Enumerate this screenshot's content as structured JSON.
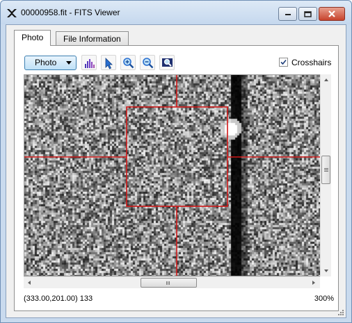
{
  "window": {
    "title": "00000958.fit - FITS Viewer",
    "controls": [
      "minimize",
      "maximize",
      "close"
    ]
  },
  "tabs": [
    {
      "label": "Photo",
      "active": true
    },
    {
      "label": "File Information",
      "active": false
    }
  ],
  "toolbar": {
    "view_mode": {
      "selected": "Photo"
    },
    "buttons": [
      {
        "name": "histogram",
        "icon": "histogram-icon"
      },
      {
        "name": "select",
        "icon": "pointer-icon"
      },
      {
        "name": "zoom-in",
        "icon": "zoom-in-icon"
      },
      {
        "name": "zoom-out",
        "icon": "zoom-out-icon"
      },
      {
        "name": "zoom-fit",
        "icon": "zoom-fit-icon"
      }
    ],
    "crosshairs": {
      "label": "Crosshairs",
      "checked": true
    }
  },
  "status": {
    "readout": "(333.00,201.00) 133",
    "zoom": "300%"
  },
  "colors": {
    "crosshair": "#d01818",
    "accent": "#3c7fb1",
    "window_frame": "#c9daee"
  }
}
